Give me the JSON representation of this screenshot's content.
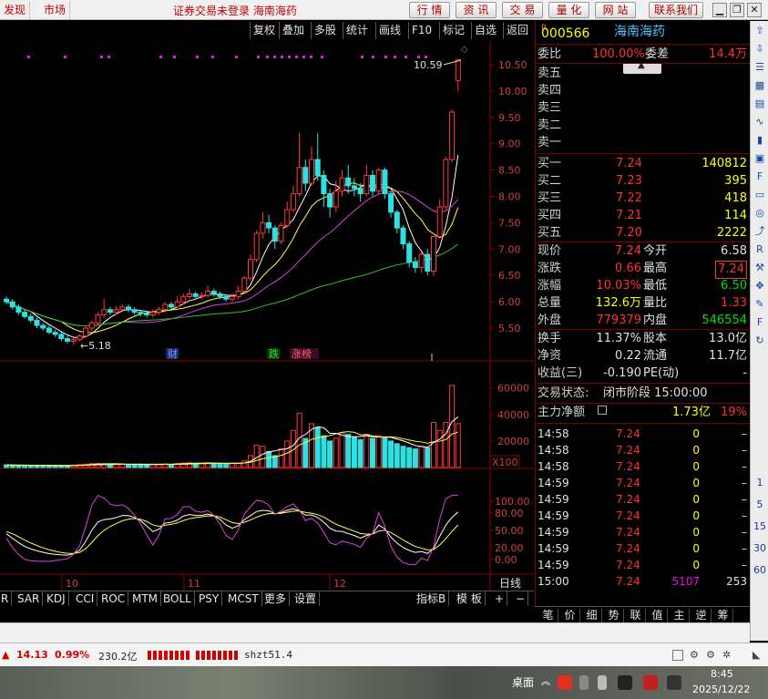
{
  "topbar": {
    "tabs": [
      "发现",
      "市场"
    ],
    "title": "证券交易未登录  海南海药",
    "buttons": [
      "行 情",
      "资 讯",
      "交 易",
      "量 化",
      "网 站",
      "联系我们"
    ]
  },
  "chart_toolbar": [
    "复权",
    "叠加",
    "多股",
    "统计",
    "画线",
    "F10",
    "标记",
    "自选",
    "返回"
  ],
  "chart_labels": {
    "high_label": "10.59",
    "low_label": "5.18",
    "volume_unit": "X100",
    "events": [
      "财",
      "跌",
      "涨榜"
    ],
    "month_labels": [
      "10",
      "11",
      "12"
    ],
    "period": "日线"
  },
  "price_axis": [
    "10.50",
    "10.00",
    "9.50",
    "9.00",
    "8.50",
    "8.00",
    "7.50",
    "7.00",
    "6.50",
    "6.00",
    "5.50"
  ],
  "volume_axis": [
    "60000",
    "40000",
    "20000"
  ],
  "kdj_axis": [
    "100.00",
    "80.00",
    "50.00",
    "20.00",
    "0.00"
  ],
  "quote": {
    "code": "000566",
    "name": "海南海药",
    "ratio_label": "委比",
    "ratio_value": "100.00%",
    "diff_label": "委差",
    "diff_value": "14.4万",
    "sell_levels": [
      "卖五",
      "卖四",
      "卖三",
      "卖二",
      "卖一"
    ],
    "buy_levels": [
      {
        "label": "买一",
        "price": "7.24",
        "volume": "140812"
      },
      {
        "label": "买二",
        "price": "7.23",
        "volume": "395"
      },
      {
        "label": "买三",
        "price": "7.22",
        "volume": "418"
      },
      {
        "label": "买四",
        "price": "7.21",
        "volume": "114"
      },
      {
        "label": "买五",
        "price": "7.20",
        "volume": "2222"
      }
    ],
    "stats": [
      {
        "l1": "现价",
        "v1": "7.24",
        "c1": "v-red",
        "l2": "今开",
        "v2": "6.58",
        "c2": "v-wht"
      },
      {
        "l1": "涨跌",
        "v1": "0.66",
        "c1": "v-red",
        "l2": "最高",
        "v2": "7.24",
        "c2": "v-red"
      },
      {
        "l1": "涨幅",
        "v1": "10.03%",
        "c1": "v-red",
        "l2": "最低",
        "v2": "6.50",
        "c2": "v-grn"
      },
      {
        "l1": "总量",
        "v1": "132.6万",
        "c1": "v-yel",
        "l2": "量比",
        "v2": "1.33",
        "c2": "v-red"
      },
      {
        "l1": "外盘",
        "v1": "779379",
        "c1": "v-red",
        "l2": "内盘",
        "v2": "546554",
        "c2": "v-grn"
      }
    ],
    "stats2": [
      {
        "l1": "换手",
        "v1": "11.37%",
        "l2": "股本",
        "v2": "13.0亿"
      },
      {
        "l1": "净资",
        "v1": "0.22",
        "l2": "流通",
        "v2": "11.7亿"
      },
      {
        "l1": "收益(三)",
        "v1": "-0.190",
        "l2": "PE(动)",
        "v2": "-"
      }
    ],
    "trade_status_label": "交易状态:",
    "trade_status": "闭市阶段 15:00:00",
    "main_flow_label": "主力净额",
    "main_flow_value": "1.73亿",
    "main_flow_pct": "19%",
    "ticks": [
      {
        "time": "14:58",
        "price": "7.24",
        "vol": "0",
        "flag": "–"
      },
      {
        "time": "14:58",
        "price": "7.24",
        "vol": "0",
        "flag": "–"
      },
      {
        "time": "14:58",
        "price": "7.24",
        "vol": "0",
        "flag": "–"
      },
      {
        "time": "14:59",
        "price": "7.24",
        "vol": "0",
        "flag": "–"
      },
      {
        "time": "14:59",
        "price": "7.24",
        "vol": "0",
        "flag": "–"
      },
      {
        "time": "14:59",
        "price": "7.24",
        "vol": "0",
        "flag": "–"
      },
      {
        "time": "14:59",
        "price": "7.24",
        "vol": "0",
        "flag": "–"
      },
      {
        "time": "14:59",
        "price": "7.24",
        "vol": "0",
        "flag": "–"
      },
      {
        "time": "14:59",
        "price": "7.24",
        "vol": "0",
        "flag": "–"
      },
      {
        "time": "15:00",
        "price": "7.24",
        "vol": "5107",
        "flag": "253"
      }
    ],
    "tabs": [
      "笔",
      "价",
      "细",
      "势",
      "联",
      "值",
      "主",
      "逆",
      "筹"
    ]
  },
  "indicator_tabs": [
    "R",
    "SAR",
    "KDJ",
    "CCI",
    "ROC",
    "MTM",
    "BOLL",
    "PSY",
    "MCST",
    "更多",
    "设置"
  ],
  "indicator_right": [
    "指标B",
    "模 板",
    "+",
    "−"
  ],
  "iconstrip": {
    "icons": [
      "nav-up-icon",
      "nav-down-icon",
      "list-icon",
      "grid-icon",
      "table-icon",
      "line-chart-icon",
      "kline-icon",
      "news-icon",
      "f10-icon",
      "doc-icon",
      "target-icon",
      "trend-icon",
      "rsi-icon",
      "tool-icon",
      "move-icon",
      "pen-icon",
      "f5-icon",
      "refresh-icon"
    ],
    "periods": [
      "1",
      "5",
      "15",
      "30",
      "60"
    ]
  },
  "statusbar": {
    "index_value": "14.13",
    "index_pct": "0.99%",
    "amount": "230.2亿",
    "ticker": "shzt51.4"
  },
  "taskbar": {
    "desktop": "桌面",
    "time": "8:45",
    "date": "2025/12/22"
  },
  "chart_data": {
    "type": "candlestick",
    "candles": [
      [
        6.05,
        6.0,
        6.1,
        5.95
      ],
      [
        6.0,
        5.9,
        6.05,
        5.85
      ],
      [
        5.9,
        5.8,
        5.95,
        5.75
      ],
      [
        5.8,
        5.72,
        5.85,
        5.68
      ],
      [
        5.72,
        5.65,
        5.78,
        5.6
      ],
      [
        5.65,
        5.55,
        5.7,
        5.5
      ],
      [
        5.55,
        5.5,
        5.6,
        5.45
      ],
      [
        5.5,
        5.42,
        5.55,
        5.38
      ],
      [
        5.42,
        5.38,
        5.47,
        5.33
      ],
      [
        5.38,
        5.3,
        5.42,
        5.25
      ],
      [
        5.3,
        5.25,
        5.35,
        5.2
      ],
      [
        5.25,
        5.28,
        5.32,
        5.18
      ],
      [
        5.28,
        5.35,
        5.38,
        5.25
      ],
      [
        5.35,
        5.5,
        5.55,
        5.32
      ],
      [
        5.5,
        5.6,
        5.65,
        5.45
      ],
      [
        5.6,
        5.75,
        5.8,
        5.55
      ],
      [
        5.75,
        5.85,
        6.05,
        5.7
      ],
      [
        5.85,
        5.8,
        5.9,
        5.75
      ],
      [
        5.8,
        5.85,
        5.92,
        5.75
      ],
      [
        5.85,
        5.9,
        5.95,
        5.8
      ],
      [
        5.9,
        5.85,
        5.95,
        5.8
      ],
      [
        5.85,
        5.8,
        5.9,
        5.75
      ],
      [
        5.8,
        5.78,
        5.85,
        5.72
      ],
      [
        5.78,
        5.75,
        5.82,
        5.7
      ],
      [
        5.75,
        5.8,
        5.85,
        5.7
      ],
      [
        5.8,
        5.85,
        5.9,
        5.75
      ],
      [
        5.85,
        5.95,
        6.0,
        5.8
      ],
      [
        5.95,
        5.9,
        6.0,
        5.85
      ],
      [
        5.9,
        6.0,
        6.1,
        5.88
      ],
      [
        6.0,
        6.1,
        6.15,
        5.95
      ],
      [
        6.1,
        6.15,
        6.25,
        6.05
      ],
      [
        6.15,
        6.1,
        6.2,
        6.05
      ],
      [
        6.1,
        6.12,
        6.18,
        6.05
      ],
      [
        6.12,
        6.2,
        6.3,
        6.08
      ],
      [
        6.2,
        6.15,
        6.25,
        6.1
      ],
      [
        6.15,
        6.1,
        6.2,
        6.05
      ],
      [
        6.1,
        6.05,
        6.15,
        6.0
      ],
      [
        6.05,
        6.1,
        6.15,
        6.0
      ],
      [
        6.1,
        6.2,
        6.3,
        6.05
      ],
      [
        6.2,
        6.45,
        6.5,
        6.15
      ],
      [
        6.45,
        6.8,
        6.9,
        6.4
      ],
      [
        6.8,
        7.3,
        7.35,
        6.75
      ],
      [
        7.3,
        7.5,
        7.7,
        7.2
      ],
      [
        7.5,
        7.4,
        7.65,
        7.3
      ],
      [
        7.4,
        7.15,
        7.45,
        7.0
      ],
      [
        7.15,
        7.45,
        7.5,
        7.1
      ],
      [
        7.45,
        7.75,
        7.9,
        7.4
      ],
      [
        7.75,
        8.05,
        8.2,
        7.7
      ],
      [
        8.05,
        8.55,
        9.2,
        8.0
      ],
      [
        8.55,
        8.25,
        8.7,
        8.1
      ],
      [
        8.25,
        8.7,
        8.95,
        8.2
      ],
      [
        8.7,
        8.4,
        9.2,
        8.3
      ],
      [
        8.4,
        8.05,
        8.5,
        7.8
      ],
      [
        8.05,
        7.8,
        8.15,
        7.6
      ],
      [
        7.8,
        8.1,
        8.3,
        7.7
      ],
      [
        8.1,
        8.35,
        8.5,
        8.0
      ],
      [
        8.35,
        8.2,
        8.6,
        8.05
      ],
      [
        8.2,
        8.15,
        8.35,
        8.0
      ],
      [
        8.15,
        8.05,
        8.25,
        7.9
      ],
      [
        8.05,
        8.4,
        8.6,
        8.0
      ],
      [
        8.4,
        8.1,
        8.5,
        8.0
      ],
      [
        8.1,
        8.5,
        8.55,
        8.05
      ],
      [
        8.5,
        8.05,
        8.55,
        7.95
      ],
      [
        8.05,
        7.7,
        8.1,
        7.6
      ],
      [
        7.7,
        7.4,
        7.75,
        7.3
      ],
      [
        7.4,
        7.1,
        7.45,
        7.0
      ],
      [
        7.1,
        6.75,
        7.15,
        6.65
      ],
      [
        6.75,
        6.65,
        6.85,
        6.55
      ],
      [
        6.65,
        6.9,
        6.95,
        6.55
      ],
      [
        6.9,
        6.58,
        7.0,
        6.5
      ],
      [
        6.58,
        7.24,
        7.24,
        6.5
      ],
      [
        7.24,
        7.8,
        7.95,
        7.2
      ],
      [
        7.8,
        8.7,
        8.75,
        7.75
      ],
      [
        8.7,
        9.6,
        9.65,
        8.65
      ],
      [
        10.2,
        10.59,
        10.59,
        10.0
      ]
    ],
    "volume": [
      2000,
      1800,
      1700,
      1600,
      1500,
      1600,
      1700,
      1500,
      1400,
      1300,
      1500,
      1800,
      2200,
      2500,
      3000,
      3200,
      2800,
      2600,
      2500,
      2400,
      2300,
      2200,
      2100,
      2000,
      2400,
      2600,
      2800,
      2500,
      3000,
      3400,
      3600,
      3300,
      3200,
      3500,
      3300,
      3100,
      2900,
      3000,
      3300,
      5000,
      9000,
      17000,
      16000,
      12000,
      9000,
      14000,
      20000,
      28000,
      41000,
      22000,
      33000,
      30000,
      24000,
      20000,
      22000,
      26000,
      25000,
      23000,
      21000,
      25000,
      22000,
      24000,
      23000,
      20000,
      18000,
      16000,
      15000,
      14000,
      16000,
      15000,
      34000,
      28000,
      34000,
      62000,
      33000
    ],
    "price_range": [
      5.18,
      10.59
    ],
    "volume_max": 62000
  }
}
